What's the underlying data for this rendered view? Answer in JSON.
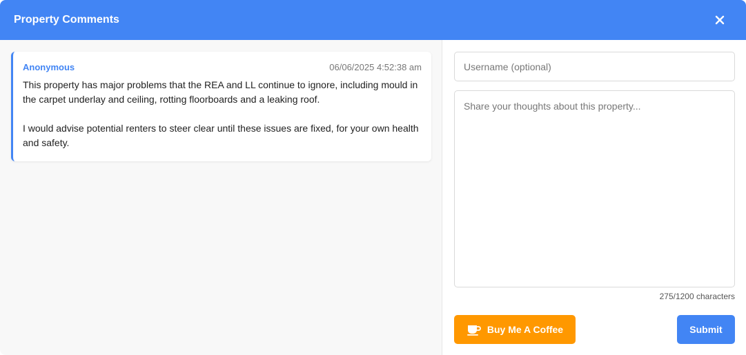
{
  "header": {
    "title": "Property Comments",
    "close_icon": "close-icon"
  },
  "comments": [
    {
      "author": "Anonymous",
      "date": "06/06/2025 4:52:38 am",
      "text": "This property has major problems that the REA and LL continue to ignore, including mould in the carpet underlay and ceiling, rotting floorboards and a leaking roof.\n\nI would advise potential renters to steer clear until these issues are fixed, for your own health and safety."
    }
  ],
  "form": {
    "username_placeholder": "Username (optional)",
    "username_value": "",
    "comment_placeholder": "Share your thoughts about this property...",
    "comment_value": "",
    "char_count": "275/1200 characters",
    "coffee_label": "Buy Me A Coffee",
    "coffee_icon": "coffee-cup-icon",
    "submit_label": "Submit"
  },
  "colors": {
    "accent": "#4285f4",
    "coffee": "#ff9800"
  }
}
